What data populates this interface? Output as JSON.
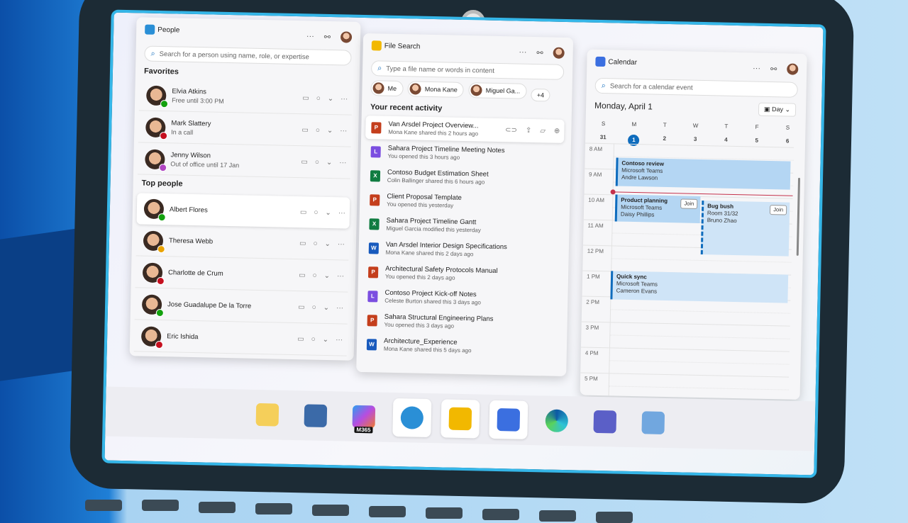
{
  "people": {
    "title": "People",
    "search_placeholder": "Search for a person using name, role, or expertise",
    "favorites_label": "Favorites",
    "top_people_label": "Top people",
    "favorites": [
      {
        "name": "Elvia Atkins",
        "status": "Free until 3:00 PM",
        "presence": "#13a10e"
      },
      {
        "name": "Mark Slattery",
        "status": "In a call",
        "presence": "#c50f1f"
      },
      {
        "name": "Jenny Wilson",
        "status": "Out of office until 17 Jan",
        "presence": "#b146c2"
      }
    ],
    "top": [
      {
        "name": "Albert Flores",
        "presence": "#13a10e"
      },
      {
        "name": "Theresa Webb",
        "presence": "#eaa300"
      },
      {
        "name": "Charlotte de Crum",
        "presence": "#c50f1f"
      },
      {
        "name": "Jose Guadalupe De la Torre",
        "presence": "#13a10e"
      },
      {
        "name": "Eric Ishida",
        "presence": "#c50f1f"
      }
    ]
  },
  "files": {
    "title": "File Search",
    "search_placeholder": "Type a file name or words in content",
    "chips": [
      "Me",
      "Mona Kane",
      "Miguel Ga..."
    ],
    "more_chip": "+4",
    "recent_label": "Your recent activity",
    "items": [
      {
        "name": "Van Arsdel Project Overview...",
        "sub": "Mona Kane shared this 2 hours ago",
        "type": "P",
        "color": "#c43e1c"
      },
      {
        "name": "Sahara Project Timeline Meeting Notes",
        "sub": "You opened this 3 hours ago",
        "type": "L",
        "color": "#7b4ee0"
      },
      {
        "name": "Contoso Budget Estimation Sheet",
        "sub": "Colin Ballinger shared this 6 hours ago",
        "type": "X",
        "color": "#107c41"
      },
      {
        "name": "Client Proposal Template",
        "sub": "You opened this yesterday",
        "type": "P",
        "color": "#c43e1c"
      },
      {
        "name": "Sahara Project Timeline Gantt",
        "sub": "Miguel Garcia modified this yesterday",
        "type": "X",
        "color": "#107c41"
      },
      {
        "name": "Van Arsdel Interior Design Specifications",
        "sub": "Mona Kane shared this 2 days ago",
        "type": "W",
        "color": "#185abd"
      },
      {
        "name": "Architectural Safety Protocols Manual",
        "sub": "You opened this 2 days ago",
        "type": "P",
        "color": "#c43e1c"
      },
      {
        "name": "Contoso Project Kick-off  Notes",
        "sub": "Celeste Burton shared this 3 days ago",
        "type": "L",
        "color": "#7b4ee0"
      },
      {
        "name": "Sahara Structural Engineering Plans",
        "sub": "You opened this 3 days ago",
        "type": "P",
        "color": "#c43e1c"
      },
      {
        "name": "Architecture_Experience",
        "sub": "Mona Kane shared this 5 days ago",
        "type": "W",
        "color": "#185abd"
      }
    ]
  },
  "calendar": {
    "title": "Calendar",
    "search_placeholder": "Search for a calendar event",
    "date": "Monday, April 1",
    "view": "Day",
    "week": [
      {
        "d": "S",
        "n": "31"
      },
      {
        "d": "M",
        "n": "1"
      },
      {
        "d": "T",
        "n": "2"
      },
      {
        "d": "W",
        "n": "3"
      },
      {
        "d": "T",
        "n": "4"
      },
      {
        "d": "F",
        "n": "5"
      },
      {
        "d": "S",
        "n": "6"
      }
    ],
    "hours": [
      "8 AM",
      "9 AM",
      "10 AM",
      "11 AM",
      "12 PM",
      "1 PM",
      "2 PM",
      "3 PM",
      "4 PM",
      "5 PM"
    ],
    "events": [
      {
        "title": "Contoso review",
        "place": "Microsoft Teams",
        "who": "Andre Lawson"
      },
      {
        "title": "Product planning",
        "place": "Microsoft Teams",
        "who": "Daisy Phillips",
        "join": "Join"
      },
      {
        "title": "Bug bush",
        "place": "Room 31/32",
        "who": "Bruno Zhao",
        "join": "Join"
      },
      {
        "title": "Quick sync",
        "place": "Microsoft Teams",
        "who": "Cameron Evans"
      }
    ]
  },
  "taskbar": {
    "m365_label": "M365"
  }
}
